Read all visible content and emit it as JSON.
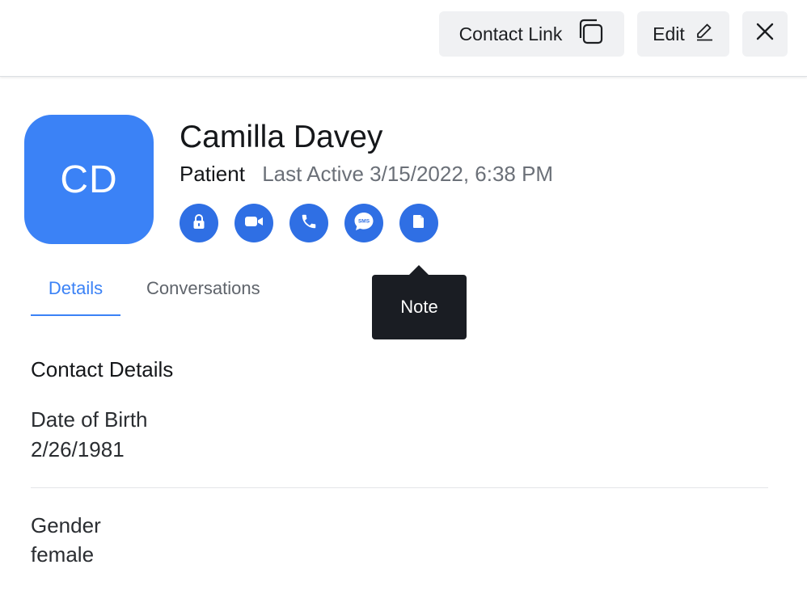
{
  "header": {
    "contact_link_label": "Contact Link",
    "edit_label": "Edit"
  },
  "profile": {
    "initials": "CD",
    "name": "Camilla Davey",
    "role": "Patient",
    "last_active": "Last Active 3/15/2022, 6:38 PM",
    "avatar_color": "#3b82f6"
  },
  "actions": [
    {
      "icon": "lock-icon"
    },
    {
      "icon": "video-icon"
    },
    {
      "icon": "phone-icon"
    },
    {
      "icon": "sms-icon",
      "label": "SMS"
    },
    {
      "icon": "note-icon"
    }
  ],
  "tooltip": {
    "text": "Note"
  },
  "tabs": [
    {
      "label": "Details",
      "active": true
    },
    {
      "label": "Conversations",
      "active": false
    }
  ],
  "details": {
    "section_title": "Contact Details",
    "fields": [
      {
        "label": "Date of Birth",
        "value": "2/26/1981"
      },
      {
        "label": "Gender",
        "value": "female"
      }
    ]
  },
  "colors": {
    "accent": "#3b82f6",
    "action_button": "#2f6fe4",
    "tooltip_bg": "#1a1d23"
  }
}
